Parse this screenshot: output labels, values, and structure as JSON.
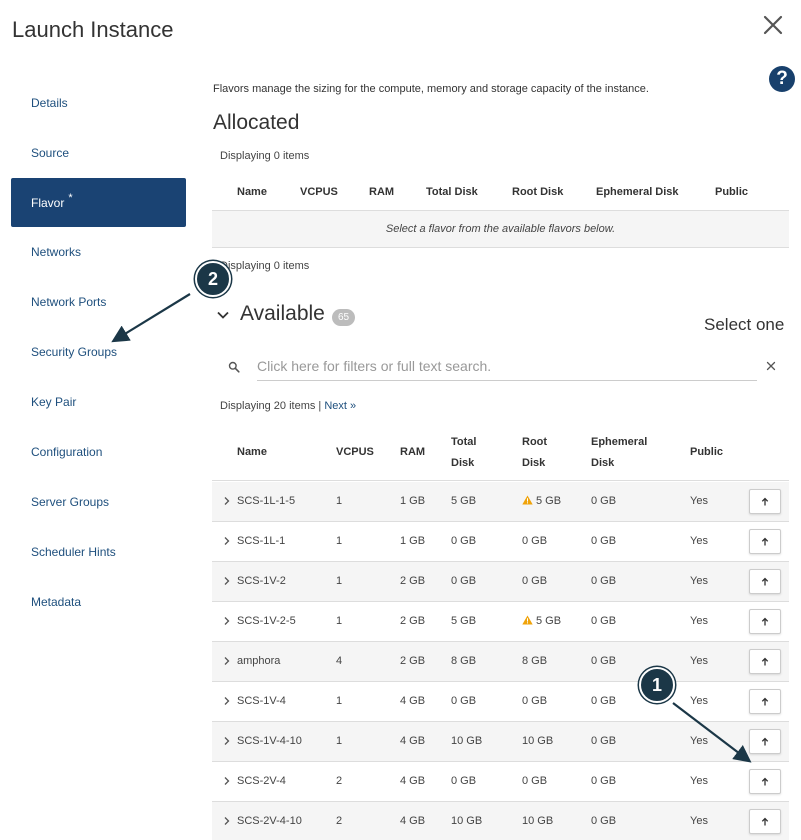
{
  "window": {
    "title": "Launch Instance"
  },
  "icons": {
    "close": "close-icon",
    "help": "help-icon",
    "search": "search-icon",
    "clear": "clear-icon",
    "expand": "chevron-right-icon",
    "collapse": "chevron-down-icon",
    "warning": "warning-icon",
    "allocate": "arrow-up-icon"
  },
  "colors": {
    "accent": "#1a4373",
    "link": "#1e4f7d",
    "warning": "#f0a30a",
    "callout": "#1b3747"
  },
  "help": {
    "label": "?"
  },
  "nav": {
    "items": [
      {
        "label": "Details"
      },
      {
        "label": "Source"
      },
      {
        "label": "Flavor",
        "required": "*",
        "active": true
      },
      {
        "label": "Networks"
      },
      {
        "label": "Network Ports"
      },
      {
        "label": "Security Groups"
      },
      {
        "label": "Key Pair"
      },
      {
        "label": "Configuration"
      },
      {
        "label": "Server Groups"
      },
      {
        "label": "Scheduler Hints"
      },
      {
        "label": "Metadata"
      }
    ]
  },
  "main": {
    "help_text": "Flavors manage the sizing for the compute, memory and storage capacity of the instance.",
    "allocated": {
      "title": "Allocated",
      "displaying_top": "Displaying 0 items",
      "displaying_bottom": "Displaying 0 items",
      "columns": [
        "Name",
        "VCPUS",
        "RAM",
        "Total Disk",
        "Root Disk",
        "Ephemeral Disk",
        "Public"
      ],
      "empty_message": "Select a flavor from the available flavors below."
    },
    "available": {
      "title": "Available",
      "count": "65",
      "select_hint": "Select one",
      "search_placeholder": "Click here for filters or full text search.",
      "search_value": "",
      "displaying": "Displaying 20 items | ",
      "next_link": "Next »",
      "columns": {
        "name": "Name",
        "vcpus": "VCPUS",
        "ram": "RAM",
        "total_disk": [
          "Total",
          "Disk"
        ],
        "root_disk": [
          "Root",
          "Disk"
        ],
        "ephemeral_disk": [
          "Ephemeral",
          "Disk"
        ],
        "public": "Public"
      },
      "rows": [
        {
          "name": "SCS-1L-1-5",
          "vcpus": "1",
          "ram": "1 GB",
          "total_disk": "5 GB",
          "root_disk": "5 GB",
          "root_warning": true,
          "ephemeral_disk": "0 GB",
          "public": "Yes"
        },
        {
          "name": "SCS-1L-1",
          "vcpus": "1",
          "ram": "1 GB",
          "total_disk": "0 GB",
          "root_disk": "0 GB",
          "root_warning": false,
          "ephemeral_disk": "0 GB",
          "public": "Yes"
        },
        {
          "name": "SCS-1V-2",
          "vcpus": "1",
          "ram": "2 GB",
          "total_disk": "0 GB",
          "root_disk": "0 GB",
          "root_warning": false,
          "ephemeral_disk": "0 GB",
          "public": "Yes"
        },
        {
          "name": "SCS-1V-2-5",
          "vcpus": "1",
          "ram": "2 GB",
          "total_disk": "5 GB",
          "root_disk": "5 GB",
          "root_warning": true,
          "ephemeral_disk": "0 GB",
          "public": "Yes"
        },
        {
          "name": "amphora",
          "vcpus": "4",
          "ram": "2 GB",
          "total_disk": "8 GB",
          "root_disk": "8 GB",
          "root_warning": false,
          "ephemeral_disk": "0 GB",
          "public": "Yes"
        },
        {
          "name": "SCS-1V-4",
          "vcpus": "1",
          "ram": "4 GB",
          "total_disk": "0 GB",
          "root_disk": "0 GB",
          "root_warning": false,
          "ephemeral_disk": "0 GB",
          "public": "Yes"
        },
        {
          "name": "SCS-1V-4-10",
          "vcpus": "1",
          "ram": "4 GB",
          "total_disk": "10 GB",
          "root_disk": "10 GB",
          "root_warning": false,
          "ephemeral_disk": "0 GB",
          "public": "Yes"
        },
        {
          "name": "SCS-2V-4",
          "vcpus": "2",
          "ram": "4 GB",
          "total_disk": "0 GB",
          "root_disk": "0 GB",
          "root_warning": false,
          "ephemeral_disk": "0 GB",
          "public": "Yes"
        },
        {
          "name": "SCS-2V-4-10",
          "vcpus": "2",
          "ram": "4 GB",
          "total_disk": "10 GB",
          "root_disk": "10 GB",
          "root_warning": false,
          "ephemeral_disk": "0 GB",
          "public": "Yes"
        }
      ]
    }
  },
  "annotations": [
    {
      "label": "1",
      "points_to": "allocate-button row SCS-2V-4"
    },
    {
      "label": "2",
      "points_to": "Security Groups"
    }
  ]
}
